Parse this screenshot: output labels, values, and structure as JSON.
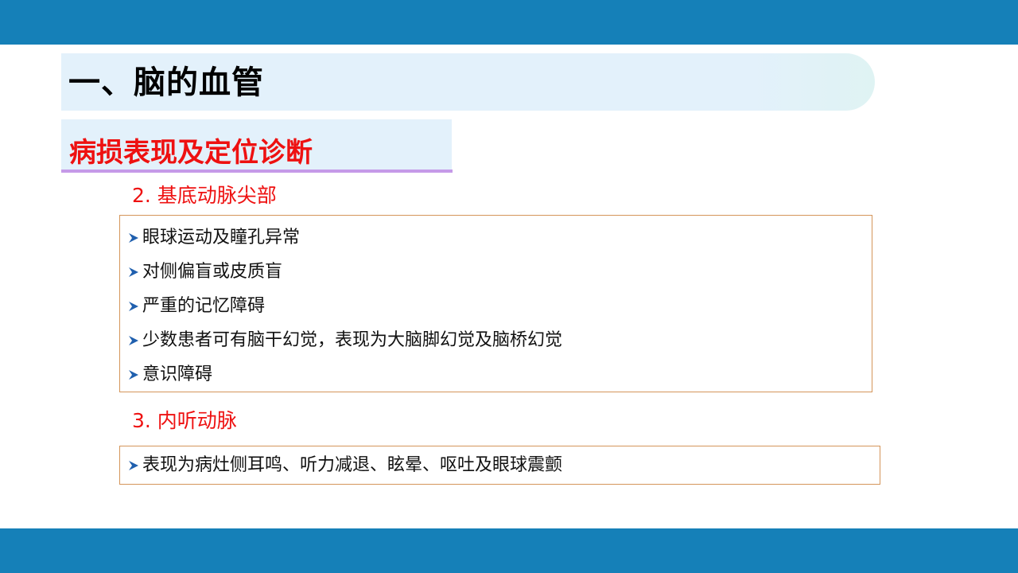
{
  "slide": {
    "title": "一、脑的血管",
    "subtitle": "病损表现及定位诊断"
  },
  "sections": [
    {
      "heading": "2. 基底动脉尖部",
      "items": [
        "眼球运动及瞳孔异常",
        "对侧偏盲或皮质盲",
        "严重的记忆障碍",
        "少数患者可有脑干幻觉，表现为大脑脚幻觉及脑桥幻觉",
        "意识障碍"
      ]
    },
    {
      "heading": "3. 内听动脉",
      "items": [
        "表现为病灶侧耳鸣、听力减退、眩晕、呕吐及眼球震颤"
      ]
    }
  ],
  "colors": {
    "bar": "#1580b8",
    "accent_red": "#ee1111",
    "box_border": "#d4955a",
    "bullet_arrow": "#1f5fae"
  },
  "icons": {
    "bullet": "arrow-bullet-icon"
  }
}
